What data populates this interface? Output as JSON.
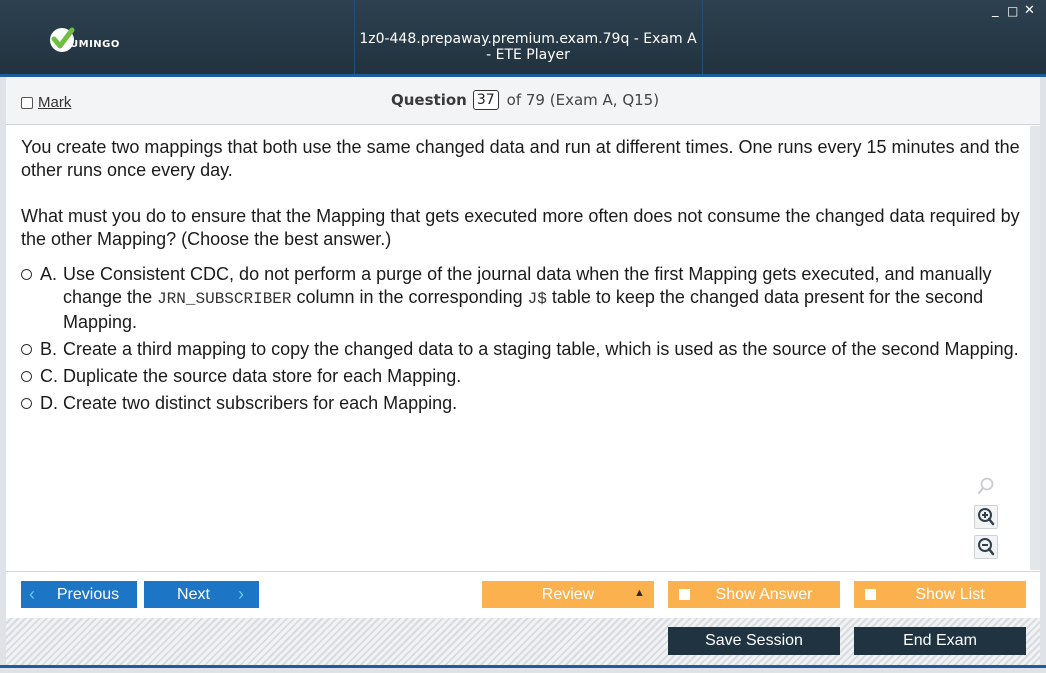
{
  "app": {
    "logo_text": "UMINGO",
    "window_title": "1z0-448.prepaway.premium.exam.79q - Exam A - ETE Player",
    "controls": [
      "_",
      "□",
      "✕"
    ]
  },
  "question_bar": {
    "mark_label": "Mark",
    "question_label": "Question",
    "question_number": "37",
    "question_of": "of 79 (Exam A, Q15)"
  },
  "question": {
    "paragraph1": "You create two mappings that both use the same changed data and run at different times. One runs every 15 minutes and the other runs once every day.",
    "paragraph2": "What must you do to ensure that the Mapping that gets executed more often does not consume the changed data required by the other Mapping? (Choose the best answer.)"
  },
  "options": [
    {
      "letter": "A.",
      "text_pre": "Use Consistent CDC, do not perform a purge of the journal data when the first Mapping gets executed, and manually change the ",
      "code1": "JRN_SUBSCRIBER",
      "text_mid": " column in the corresponding ",
      "code2": "J$",
      "text_post": " table to keep the changed data present for the second Mapping."
    },
    {
      "letter": "B.",
      "text": "Create a third mapping to copy the changed data to a staging table, which is used as the source of the second Mapping."
    },
    {
      "letter": "C.",
      "text": "Duplicate the source data store for each Mapping."
    },
    {
      "letter": "D.",
      "text": "Create two distinct subscribers for each Mapping."
    }
  ],
  "nav": {
    "previous": "Previous",
    "next": "Next",
    "review": "Review",
    "show_answer": "Show Answer",
    "show_list": "Show List",
    "save_session": "Save Session",
    "end_exam": "End Exam"
  },
  "icons": {
    "zoom_reset": "magnifier-icon",
    "zoom_in": "zoom-in-icon",
    "zoom_out": "zoom-out-icon"
  },
  "colors": {
    "titlebar": "#2d4150",
    "accent_blue": "#1c76c5",
    "orange": "#fbb24e",
    "dark_button": "#1f3340"
  }
}
